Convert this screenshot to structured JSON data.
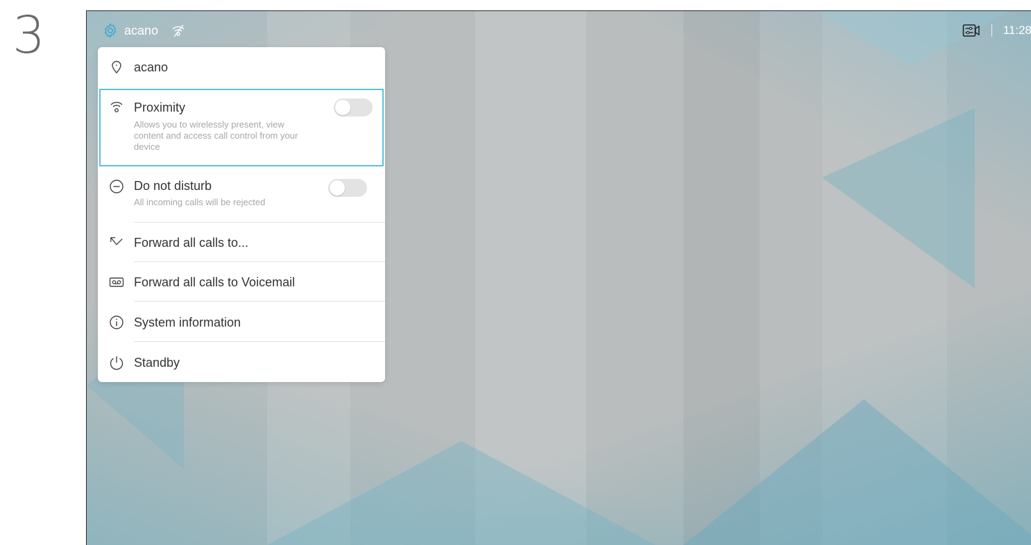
{
  "step_number": "3",
  "topbar": {
    "system_name": "acano",
    "time": "11:28"
  },
  "menu": {
    "header": "acano",
    "items": [
      {
        "label": "Proximity",
        "description": "Allows you to wirelessly present, view content and access call control from your device",
        "toggle_on": false,
        "icon": "proximity-icon"
      },
      {
        "label": "Do not disturb",
        "description": "All incoming calls will be rejected",
        "toggle_on": false,
        "icon": "minus-circle-icon"
      },
      {
        "label": "Forward all calls to...",
        "icon": "forward-arrow-icon"
      },
      {
        "label": "Forward all calls to Voicemail",
        "icon": "voicemail-icon"
      },
      {
        "label": "System information",
        "icon": "info-icon"
      },
      {
        "label": "Standby",
        "icon": "power-icon"
      }
    ]
  },
  "colors": {
    "accent": "#5bc0de",
    "gear": "#3aa7d8"
  }
}
